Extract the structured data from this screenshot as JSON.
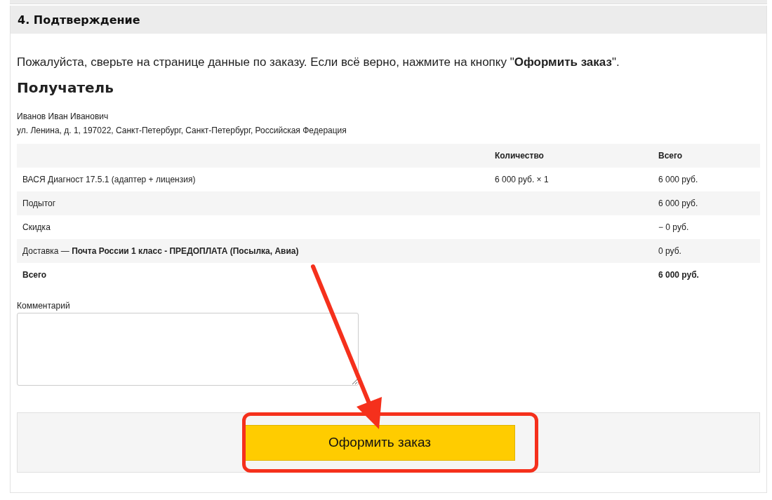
{
  "section": {
    "title": "4. Подтверждение"
  },
  "intro": "Пожалуйста, сверьте на странице данные по заказу. Если всё верно, нажмите на кнопку \"**Оформить заказ**\".",
  "recipient": {
    "heading": "Получатель",
    "name": "Иванов Иван Иванович",
    "address": "ул. Ленина, д. 1, 197022, Санкт-Петербург, Санкт-Петербург, Российская Федерация"
  },
  "table": {
    "columns": [
      "",
      "Количество",
      "Всего"
    ],
    "rows": [
      {
        "kind": "line",
        "cells": [
          "ВАСЯ Диагност 17.5.1 (адаптер + лицензия)",
          "6 000 руб. × 1",
          "6 000 руб."
        ]
      },
      {
        "kind": "line",
        "cells": [
          "Подытог",
          "",
          "6 000 руб."
        ]
      },
      {
        "kind": "line",
        "cells": [
          "Скидка",
          "",
          "− 0 руб."
        ]
      },
      {
        "kind": "line",
        "cells": [
          "Доставка — **Почта России 1 класс - ПРЕДОПЛАТА (Посылка, Авиа)**",
          "",
          "0 руб."
        ]
      },
      {
        "kind": "total",
        "cells": [
          "Всего",
          "",
          "6 000 руб."
        ]
      }
    ]
  },
  "comment": {
    "label": "Комментарий"
  },
  "submit": {
    "label": "Оформить заказ"
  }
}
